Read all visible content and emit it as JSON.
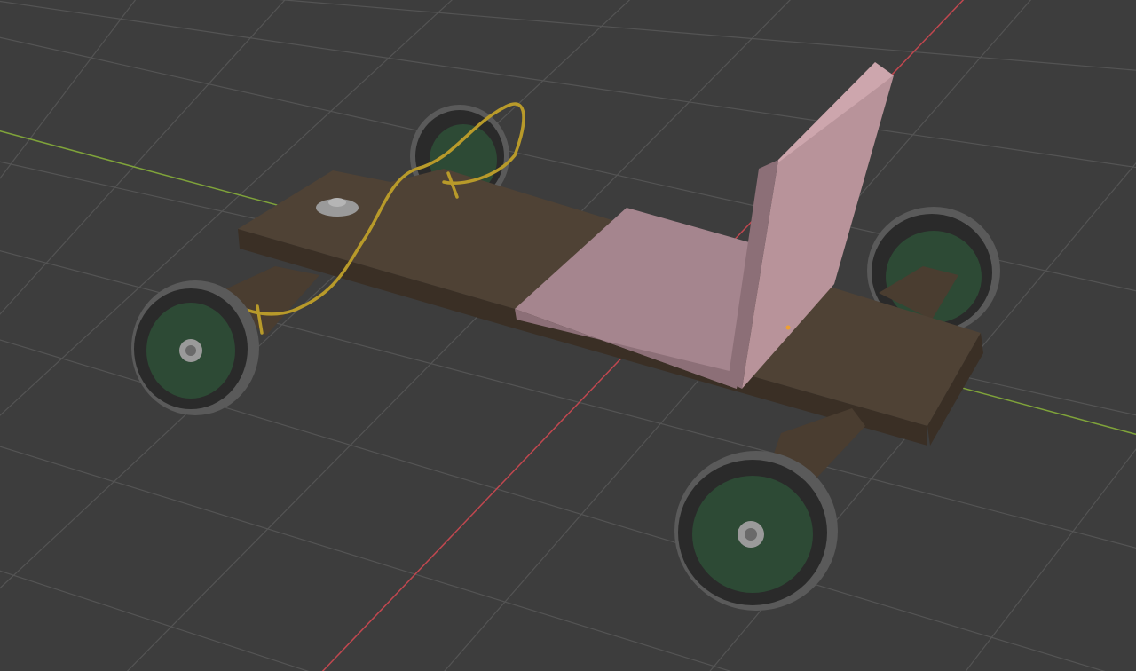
{
  "viewport": {
    "background": "#3d3d3d",
    "grid_color": "#545454",
    "x_axis_color": "#c0474f",
    "y_axis_color": "#7fa33a",
    "origin_color": "#f0a030"
  },
  "model": {
    "objects": [
      "wooden-deck",
      "front-axle-beam",
      "rear-axle-beam",
      "seat-base",
      "seat-back",
      "steering-rope",
      "pivot-bolt",
      "wheel-front-left",
      "wheel-front-right",
      "wheel-rear-left",
      "wheel-rear-right"
    ],
    "colors": {
      "wood_top": "#4f4235",
      "wood_side": "#3a2f25",
      "wood_beam": "#4a3d30",
      "seat_top": "#a5858e",
      "seat_side": "#8c6f77",
      "seat_back_front": "#b8939a",
      "tire": "#2a2a2a",
      "tire_edge": "#5a5a5a",
      "rim": "#2d4a35",
      "rope": "#b89a2a",
      "nut": "#9a9a9a"
    }
  }
}
